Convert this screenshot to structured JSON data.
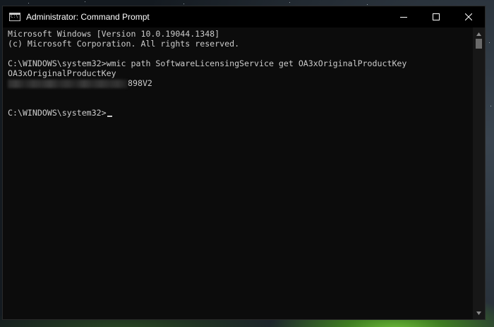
{
  "window": {
    "title": "Administrator: Command Prompt",
    "icon_label": "C:\\"
  },
  "caption_buttons": {
    "minimize_icon": "minimize-icon",
    "maximize_icon": "maximize-icon",
    "close_icon": "close-icon"
  },
  "console": {
    "lines": [
      "Microsoft Windows [Version 10.0.19044.1348]",
      "(c) Microsoft Corporation. All rights reserved.",
      "",
      "C:\\WINDOWS\\system32>wmic path SoftwareLicensingService get OA3xOriginalProductKey",
      "OA3xOriginalProductKey",
      "898V2",
      "",
      "",
      "C:\\WINDOWS\\system32>"
    ]
  },
  "colors": {
    "console_bg": "#0c0c0c",
    "console_text": "#cccccc",
    "titlebar_bg": "#000000"
  }
}
